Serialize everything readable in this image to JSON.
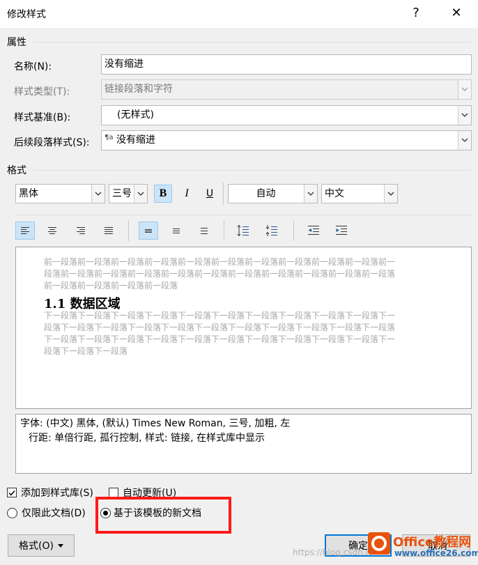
{
  "window": {
    "title": "修改样式",
    "help": "?",
    "close": "✕"
  },
  "properties": {
    "section": "属性",
    "name": {
      "label": "名称(N):",
      "value": "没有缩进"
    },
    "style_type": {
      "label": "样式类型(T):",
      "value": "链接段落和字符"
    },
    "style_based_on": {
      "label": "样式基准(B):",
      "value": "(无样式)"
    },
    "next_style": {
      "label": "后续段落样式(S):",
      "icon": "¶a",
      "value": "没有缩进"
    }
  },
  "format": {
    "section": "格式",
    "font": "黑体",
    "size": "三号",
    "bold": "B",
    "italic": "I",
    "underline": "U",
    "color": "自动",
    "script": "中文"
  },
  "preview": {
    "prev_text": "前一段落前一段落前一段落前一段落前一段落前一段落前一段落前一段落前一段落前一段落前一段落前一段落前一段落前一段落前一段落前一段落前一段落前一段落前一段落前一段落前一段落前一段落前一段落前一段落",
    "prev_l1": "前一段落前一段落前一段落前一段落前一段落前一段落前一段落前一段落前一段落前一段落前一",
    "prev_l2": "段落前一段落前一段落前一段落前一段落前一段落前一段落前一段落前一段落前一段落前一段落",
    "prev_l3": "前一段落前一段落前一段落前一段落",
    "heading": "1.1  数据区域",
    "next_l1": "下一段落下一段落下一段落下一段落下一段落下一段落下一段落下一段落下一段落下一段落下一",
    "next_l2": "段落下一段落下一段落下一段落下一段落下一段落下一段落下一段落下一段落下一段落下一段落",
    "next_l3": "下一段落下一段落下一段落下一段落下一段落下一段落下一段落下一段落下一段落下一段落下一",
    "next_l4": "段落下一段落下一段落"
  },
  "description": {
    "line1": "字体: (中文) 黑体, (默认) Times New Roman, 三号, 加粗, 左",
    "line2": "行距: 单倍行距, 孤行控制, 样式: 链接, 在样式库中显示"
  },
  "options": {
    "add_to_gallery": "添加到样式库(S)",
    "auto_update": "自动更新(U)",
    "only_this_doc": "仅限此文档(D)",
    "new_docs_template": "基于该模板的新文档"
  },
  "buttons": {
    "format": "格式(O)",
    "ok": "确定",
    "cancel": "取消"
  },
  "watermark": "https://blog.csdn.n",
  "logo": {
    "text": "Office教程网",
    "sub": "www.office26.com"
  }
}
